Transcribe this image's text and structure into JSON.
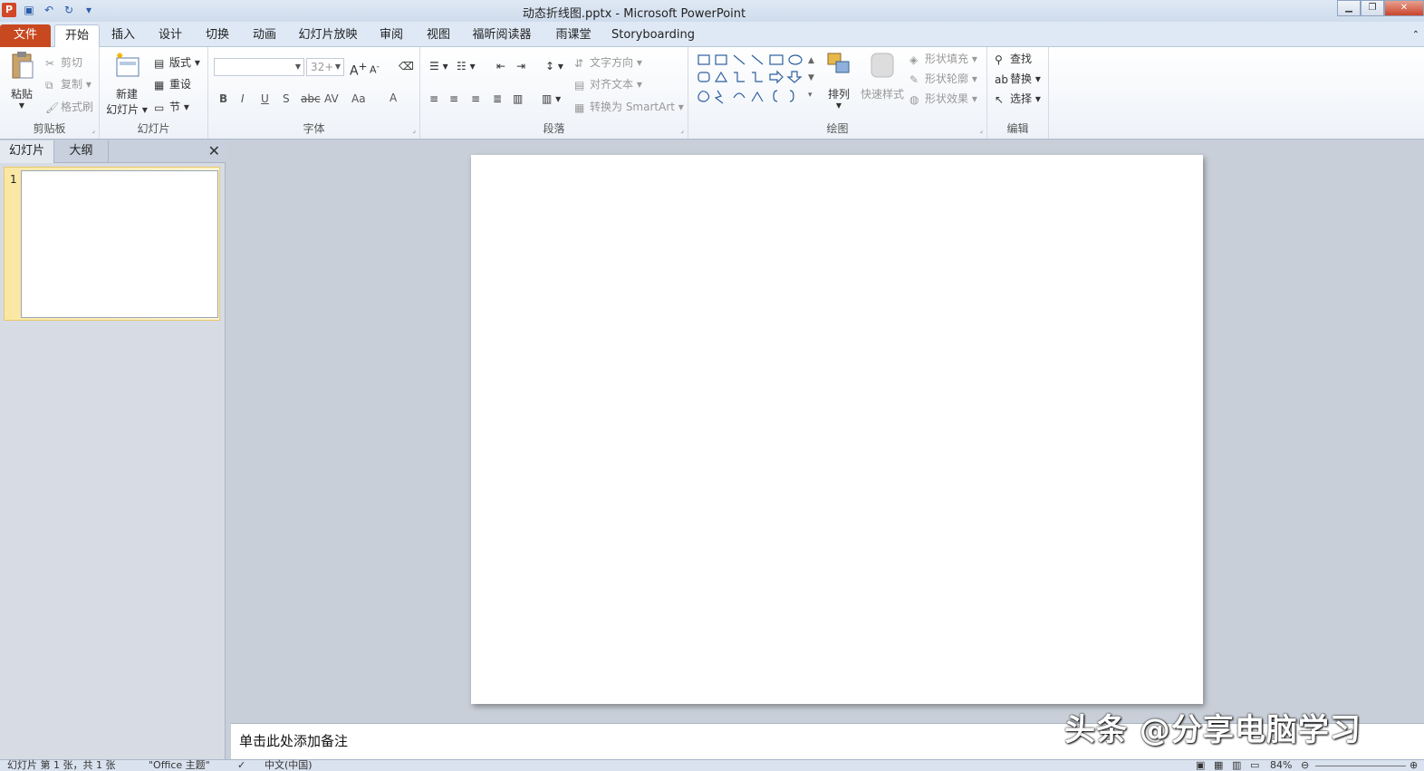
{
  "title": "动态折线图.pptx - Microsoft PowerPoint",
  "quick_access": {
    "app_icon": "P"
  },
  "tabs": [
    "文件",
    "开始",
    "插入",
    "设计",
    "切换",
    "动画",
    "幻灯片放映",
    "审阅",
    "视图",
    "福昕阅读器",
    "雨课堂",
    "Storyboarding"
  ],
  "clipboard": {
    "paste": "粘贴",
    "cut": "剪切",
    "copy": "复制",
    "format_painter": "格式刷",
    "label": "剪贴板"
  },
  "slides_group": {
    "new_slide_1": "新建",
    "new_slide_2": "幻灯片",
    "layout": "版式",
    "reset": "重设",
    "section": "节",
    "label": "幻灯片"
  },
  "font": {
    "font_name": "",
    "font_size": "32+",
    "label": "字体",
    "bold": "B",
    "italic": "I",
    "underline": "U",
    "shadow": "S",
    "strike": "abc",
    "spacing": "AV",
    "case": "Aa",
    "color": "A"
  },
  "paragraph": {
    "text_direction": "文字方向",
    "align_text": "对齐文本",
    "smartart": "转换为 SmartArt",
    "label": "段落"
  },
  "drawing": {
    "arrange": "排列",
    "quick_styles": "快速样式",
    "shape_fill": "形状填充",
    "shape_outline": "形状轮廓",
    "shape_effects": "形状效果",
    "label": "绘图"
  },
  "editing": {
    "find": "查找",
    "replace": "替换",
    "select": "选择",
    "label": "编辑"
  },
  "pane": {
    "tab_slides": "幻灯片",
    "tab_outline": "大纲",
    "slide_number": "1"
  },
  "notes": {
    "placeholder": "单击此处添加备注"
  },
  "status": {
    "slide_info": "幻灯片 第 1 张，共 1 张",
    "theme": "\"Office 主题\"",
    "language": "中文(中国)",
    "zoom": "84%"
  },
  "watermark": "头条 @分享电脑学习"
}
